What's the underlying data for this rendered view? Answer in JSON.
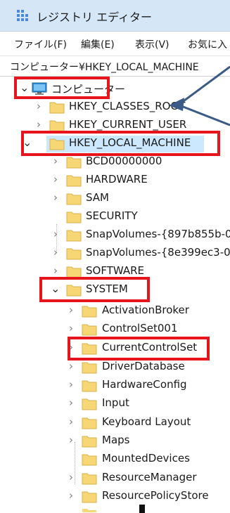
{
  "window": {
    "title": "レジストリ エディター"
  },
  "menu": [
    "ファイル(F)",
    "編集(E)",
    "表示(V)",
    "お気に入"
  ],
  "address": "コンピューター¥HKEY_LOCAL_MACHINE",
  "tree": {
    "root": "コンピューター",
    "hives": [
      "HKEY_CLASSES_ROOT",
      "HKEY_CURRENT_USER",
      "HKEY_LOCAL_MACHINE"
    ],
    "hklm_children": [
      "BCD00000000",
      "HARDWARE",
      "SAM",
      "SECURITY",
      "SnapVolumes-{897b855b-0",
      "SnapVolumes-{8e399ec3-00",
      "SOFTWARE",
      "SYSTEM"
    ],
    "system_children": [
      "ActivationBroker",
      "ControlSet001",
      "CurrentControlSet",
      "DriverDatabase",
      "HardwareConfig",
      "Input",
      "Keyboard Layout",
      "Maps",
      "MountedDevices",
      "ResourceManager",
      "ResourcePolicyStore"
    ]
  },
  "colors": {
    "highlight": "#e8141c",
    "arrow": "#3b5a86",
    "folder": "#f7d675",
    "selection": "#cce8ff"
  },
  "icons": {
    "chevron_collapsed": "›",
    "chevron_expanded": "⌄",
    "computer": "computer-icon",
    "folder": "folder-icon"
  }
}
